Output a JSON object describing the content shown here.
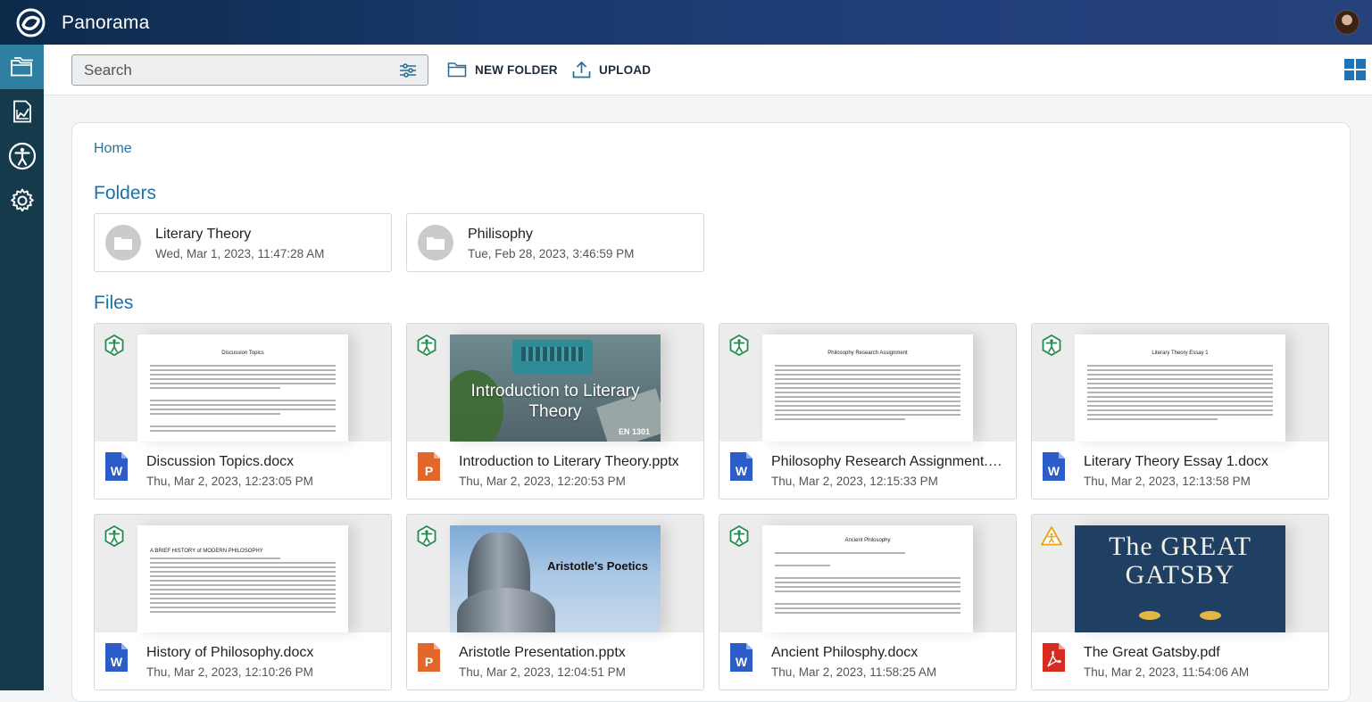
{
  "app": {
    "title": "Panorama"
  },
  "toolbar": {
    "search_placeholder": "Search",
    "new_folder_label": "NEW FOLDER",
    "upload_label": "UPLOAD"
  },
  "sidebar": {
    "items": [
      {
        "icon": "folders-icon",
        "active": true
      },
      {
        "icon": "report-chart-icon",
        "active": false
      },
      {
        "icon": "accessibility-icon",
        "active": false
      },
      {
        "icon": "settings-gear-icon",
        "active": false
      }
    ]
  },
  "content": {
    "breadcrumb": "Home",
    "folders_heading": "Folders",
    "files_heading": "Files",
    "folders": [
      {
        "name": "Literary Theory",
        "date": "Wed, Mar 1, 2023, 11:47:28 AM"
      },
      {
        "name": "Philisophy",
        "date": "Tue, Feb 28, 2023, 3:46:59 PM"
      }
    ],
    "files": [
      {
        "name": "Discussion Topics.docx",
        "date": "Thu, Mar 2, 2023, 12:23:05 PM",
        "type": "word",
        "accessibility": "good",
        "thumb_title": "Discussion Topics"
      },
      {
        "name": "Introduction to Literary Theory.pptx",
        "date": "Thu, Mar 2, 2023, 12:20:53 PM",
        "type": "powerpoint",
        "accessibility": "good",
        "thumb_title": "Introduction to Literary Theory",
        "thumb_sub": "EN 1301"
      },
      {
        "name": "Philosophy Research Assignment.d...",
        "date": "Thu, Mar 2, 2023, 12:15:33 PM",
        "type": "word",
        "accessibility": "good",
        "thumb_title": "Philosophy Research Assignment"
      },
      {
        "name": "Literary Theory Essay 1.docx",
        "date": "Thu, Mar 2, 2023, 12:13:58 PM",
        "type": "word",
        "accessibility": "good",
        "thumb_title": "Literary Theory Essay 1"
      },
      {
        "name": "History of Philosophy.docx",
        "date": "Thu, Mar 2, 2023, 12:10:26 PM",
        "type": "word",
        "accessibility": "good",
        "thumb_title": "A BRIEF HISTORY of MODERN PHILOSOPHY"
      },
      {
        "name": "Aristotle Presentation.pptx",
        "date": "Thu, Mar 2, 2023, 12:04:51 PM",
        "type": "powerpoint",
        "accessibility": "good",
        "thumb_title": "Aristotle's Poetics"
      },
      {
        "name": "Ancient Philosphy.docx",
        "date": "Thu, Mar 2, 2023, 11:58:25 AM",
        "type": "word",
        "accessibility": "good",
        "thumb_title": "Ancient Philosophy"
      },
      {
        "name": "The Great Gatsby.pdf",
        "date": "Thu, Mar 2, 2023, 11:54:06 AM",
        "type": "pdf",
        "accessibility": "warning",
        "thumb_title": "The GREAT GATSBY"
      }
    ]
  },
  "colors": {
    "topbar": "#17396b",
    "sidebar": "#143a4c",
    "sidebar_active": "#2f7fa0",
    "heading_blue": "#1a73a8",
    "a11y_good": "#1f8a4c",
    "a11y_warning": "#e8a317",
    "word_blue": "#2b5cc7",
    "ppt_orange": "#e2672b",
    "pdf_red": "#d62b1f"
  }
}
